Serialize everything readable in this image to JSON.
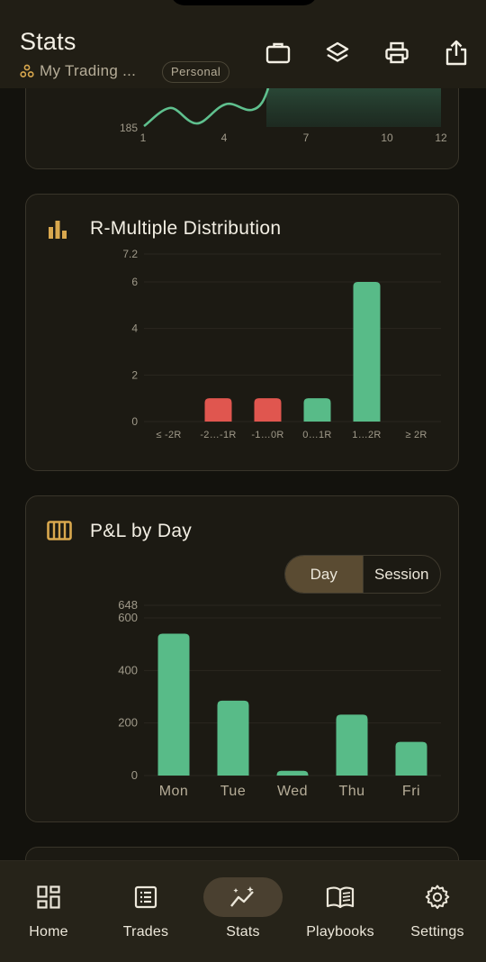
{
  "header": {
    "title": "Stats",
    "subtitle": "My Trading ...",
    "badge": "Personal"
  },
  "equity_chart": {
    "y_label": "185",
    "x_labels": [
      "1",
      "4",
      "7",
      "10",
      "12"
    ],
    "line_color": "#5fc08e"
  },
  "r_multiple": {
    "title": "R-Multiple Distribution",
    "chart_data": {
      "type": "bar",
      "title": "R-Multiple Distribution",
      "categories": [
        "≤ -2R",
        "-2…-1R",
        "-1…0R",
        "0…1R",
        "1…2R",
        "≥ 2R"
      ],
      "values": [
        0,
        1,
        1,
        1,
        6,
        0
      ],
      "colors": [
        "#e0564f",
        "#e0564f",
        "#e0564f",
        "#58bb88",
        "#58bb88",
        "#58bb88"
      ],
      "ylim": [
        0,
        7.2
      ],
      "yticks": [
        "7.2",
        "6",
        "4",
        "2",
        "0"
      ],
      "grid": true
    }
  },
  "pnl_by_day": {
    "title": "P&L by Day",
    "segments": {
      "day": "Day",
      "session": "Session",
      "selected": "Day"
    },
    "chart_data": {
      "type": "bar",
      "title": "P&L by Day",
      "categories": [
        "Mon",
        "Tue",
        "Wed",
        "Thu",
        "Fri"
      ],
      "values": [
        540,
        285,
        18,
        232,
        128
      ],
      "color": "#58bb88",
      "ylim": [
        0,
        648
      ],
      "yticks": [
        "648",
        "600",
        "400",
        "200",
        "0"
      ],
      "grid": true
    }
  },
  "tabs": [
    {
      "label": "Home",
      "icon": "dashboard-icon"
    },
    {
      "label": "Trades",
      "icon": "list-icon"
    },
    {
      "label": "Stats",
      "icon": "stats-icon",
      "active": true
    },
    {
      "label": "Playbooks",
      "icon": "book-icon"
    },
    {
      "label": "Settings",
      "icon": "gear-icon"
    }
  ],
  "colors": {
    "accent": "#d9a84e",
    "positive": "#58bb88",
    "negative": "#e0564f",
    "background": "#13120d",
    "card": "#1c1a13"
  }
}
